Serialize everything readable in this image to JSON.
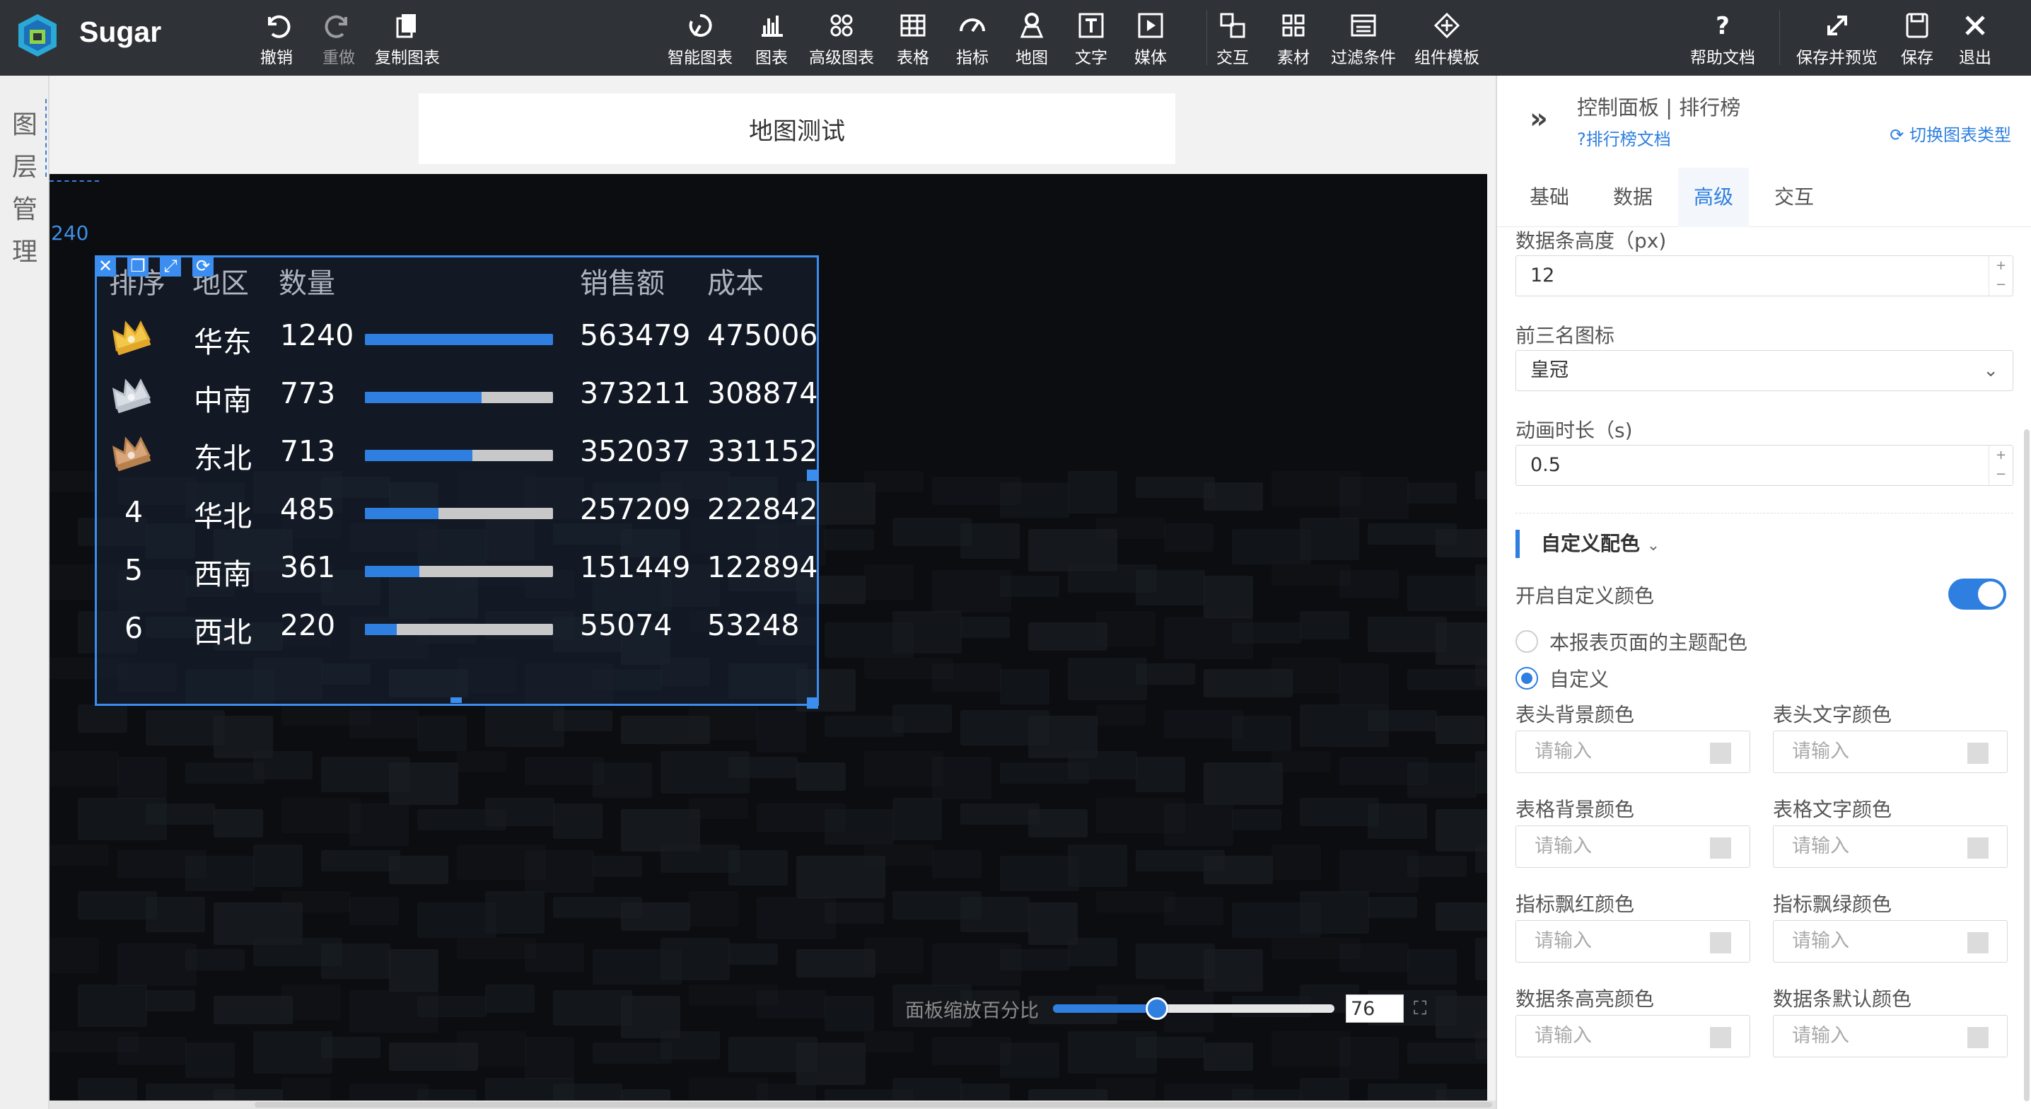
{
  "app": {
    "name": "Sugar"
  },
  "toolbar": {
    "left": [
      {
        "label": "撤销",
        "icon": "undo-icon",
        "dim": false
      },
      {
        "label": "重做",
        "icon": "redo-icon",
        "dim": true
      },
      {
        "label": "复制图表",
        "icon": "copy-icon",
        "dim": false
      }
    ],
    "center": [
      {
        "label": "智能图表",
        "icon": "smart-chart-icon"
      },
      {
        "label": "图表",
        "icon": "bar-chart-icon"
      },
      {
        "label": "高级图表",
        "icon": "advanced-chart-icon"
      },
      {
        "label": "表格",
        "icon": "table-icon"
      },
      {
        "label": "指标",
        "icon": "gauge-icon"
      },
      {
        "label": "地图",
        "icon": "map-pin-icon"
      },
      {
        "label": "文字",
        "icon": "text-icon"
      },
      {
        "label": "媒体",
        "icon": "media-play-icon"
      },
      {
        "label": "交互",
        "icon": "interaction-icon"
      },
      {
        "label": "素材",
        "icon": "grid-icon"
      },
      {
        "label": "过滤条件",
        "icon": "filter-icon"
      },
      {
        "label": "组件模板",
        "icon": "component-template-icon"
      }
    ],
    "right": [
      {
        "label": "帮助文档",
        "icon": "help-icon"
      },
      {
        "label": "保存并预览",
        "icon": "expand-icon"
      },
      {
        "label": "保存",
        "icon": "save-icon"
      },
      {
        "label": "退出",
        "icon": "close-icon"
      }
    ]
  },
  "layer_panel": {
    "label": [
      "图",
      "层",
      "管",
      "理"
    ]
  },
  "page": {
    "title": "地图测试"
  },
  "canvas": {
    "ruler_value": "240"
  },
  "widget": {
    "tools": [
      "✕",
      "❐",
      "⤢",
      "⟳"
    ],
    "headers": [
      "排序",
      "地区",
      "数量",
      "销售额",
      "成本"
    ],
    "rows": [
      {
        "rank": "",
        "medal": "gold",
        "region": "华东",
        "qty": "1240",
        "progress": 1.0,
        "sales": "563479",
        "cost": "475006"
      },
      {
        "rank": "",
        "medal": "silver",
        "region": "中南",
        "qty": "773",
        "progress": 0.62,
        "sales": "373211",
        "cost": "308874"
      },
      {
        "rank": "",
        "medal": "bronze",
        "region": "东北",
        "qty": "713",
        "progress": 0.57,
        "sales": "352037",
        "cost": "331152"
      },
      {
        "rank": "4",
        "medal": "",
        "region": "华北",
        "qty": "485",
        "progress": 0.39,
        "sales": "257209",
        "cost": "222842"
      },
      {
        "rank": "5",
        "medal": "",
        "region": "西南",
        "qty": "361",
        "progress": 0.29,
        "sales": "151449",
        "cost": "122894"
      },
      {
        "rank": "6",
        "medal": "",
        "region": "西北",
        "qty": "220",
        "progress": 0.17,
        "sales": "55074",
        "cost": "53248"
      }
    ],
    "bar_color": "#2e7fe0",
    "bar_track_color": "#c8c8c8"
  },
  "zoom": {
    "label": "面板缩放百分比",
    "value": "76",
    "percent": 0.37
  },
  "panel": {
    "title": "控制面板 | 排行榜",
    "doc_link": "?排行榜文档",
    "switch_link": "切换图表类型",
    "tabs": [
      "基础",
      "数据",
      "高级",
      "交互"
    ],
    "active_tab": "高级",
    "bar_height": {
      "label": "数据条高度（px)",
      "value": "12"
    },
    "top3_icon": {
      "label": "前三名图标",
      "value": "皇冠"
    },
    "anim": {
      "label": "动画时长（s)",
      "value": "0.5"
    },
    "custom_section": "自定义配色",
    "enable_custom": {
      "label": "开启自定义颜色",
      "on": true
    },
    "radio_theme": "本报表页面的主题配色",
    "radio_custom": "自定义",
    "colors": [
      {
        "label": "表头背景颜色",
        "placeholder": "请输入"
      },
      {
        "label": "表头文字颜色",
        "placeholder": "请输入"
      },
      {
        "label": "表格背景颜色",
        "placeholder": "请输入"
      },
      {
        "label": "表格文字颜色",
        "placeholder": "请输入"
      },
      {
        "label": "指标飘红颜色",
        "placeholder": "请输入"
      },
      {
        "label": "指标飘绿颜色",
        "placeholder": "请输入"
      },
      {
        "label": "数据条高亮颜色",
        "placeholder": "请输入"
      },
      {
        "label": "数据条默认颜色",
        "placeholder": "请输入"
      }
    ],
    "accent": "#2e7fe0"
  }
}
